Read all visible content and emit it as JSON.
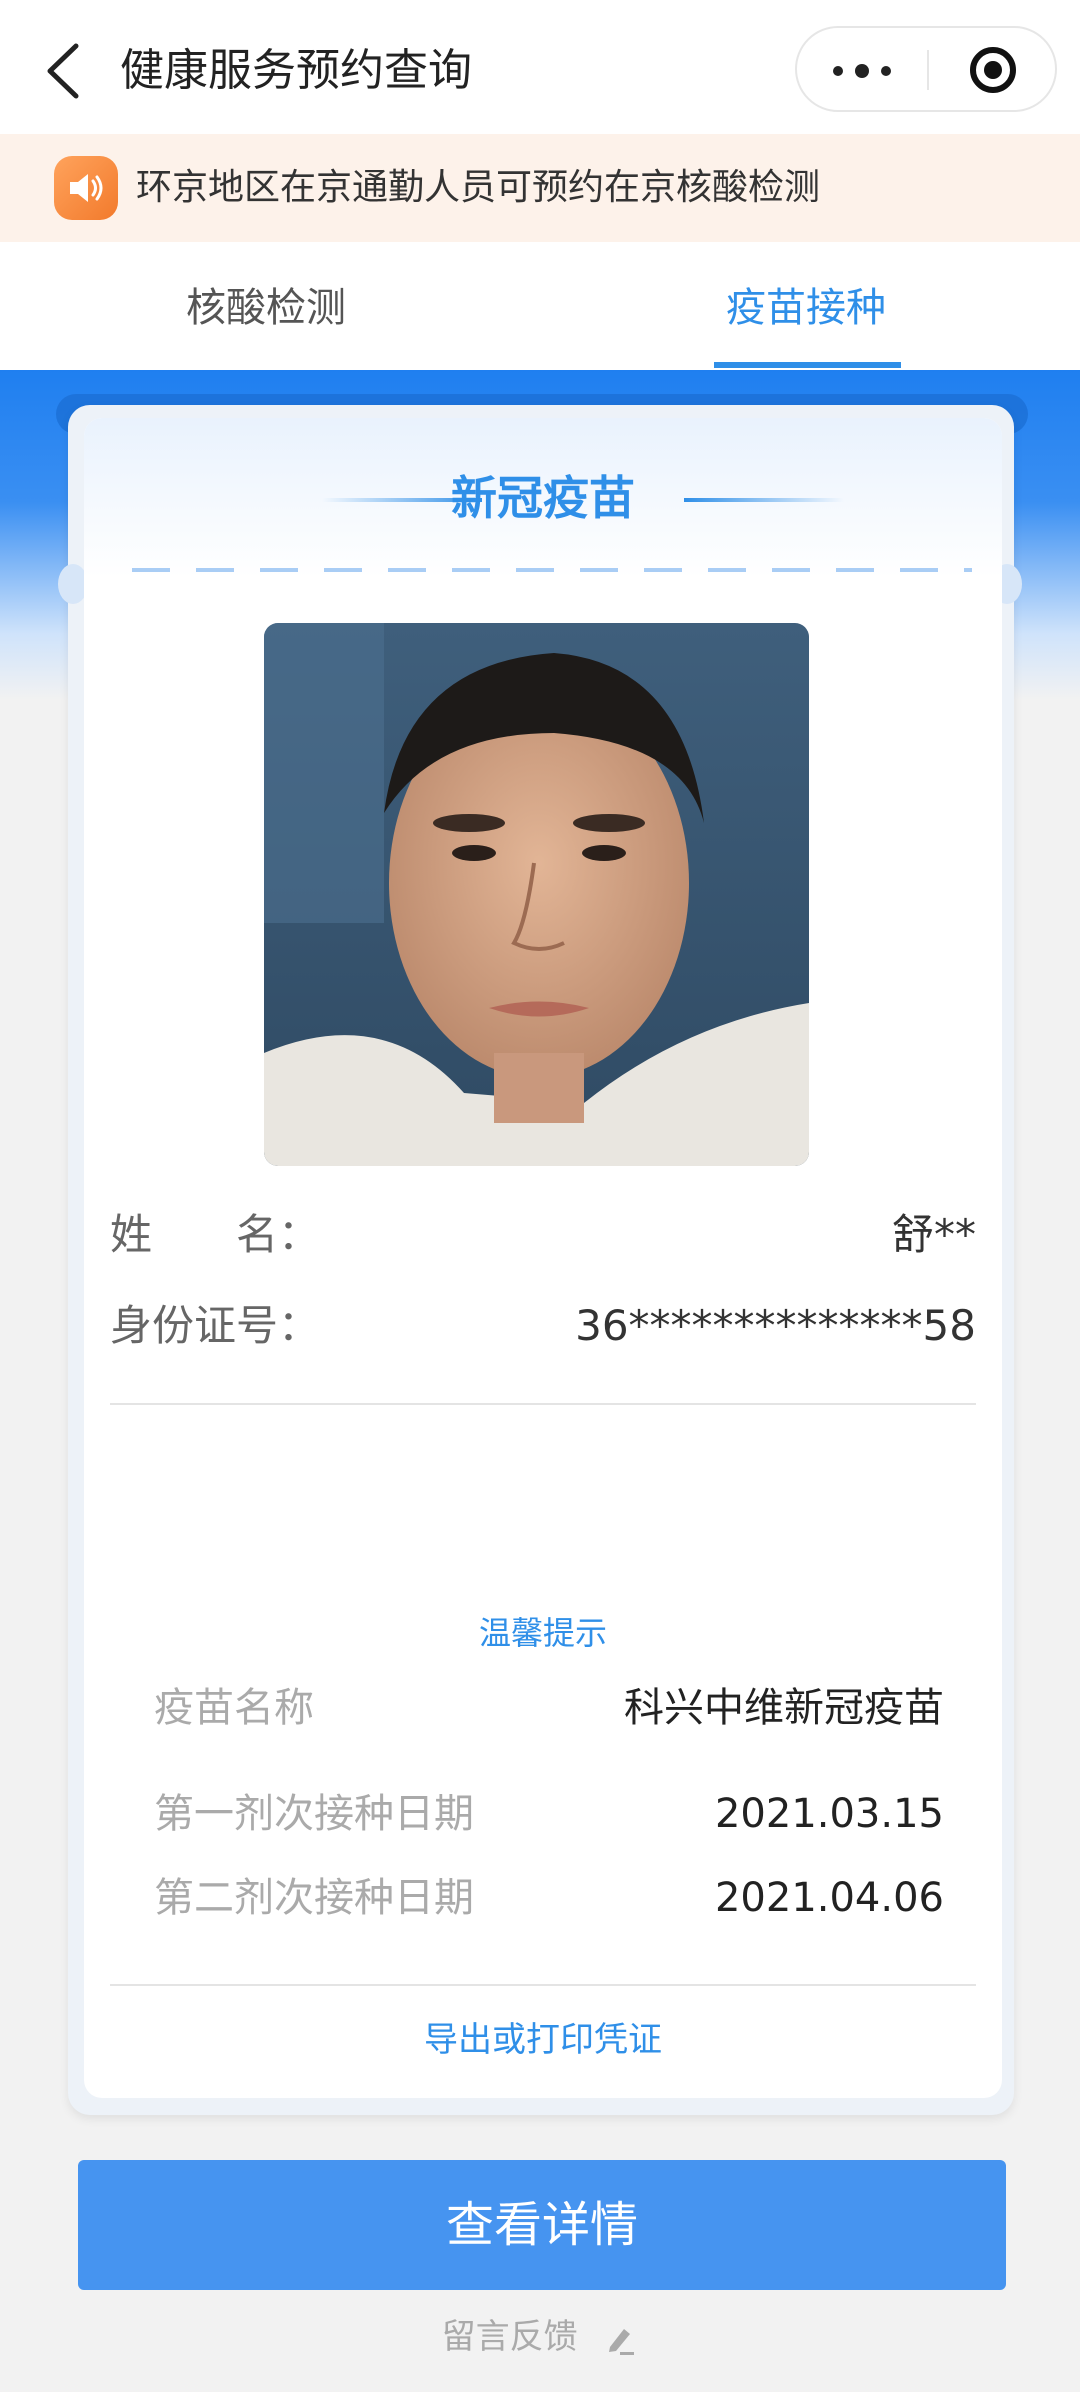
{
  "header": {
    "title": "健康服务预约查询"
  },
  "notice": {
    "text": "环京地区在京通勤人员可预约在京核酸检测"
  },
  "tabs": [
    {
      "label": "核酸检测",
      "active": false
    },
    {
      "label": "疫苗接种",
      "active": true
    }
  ],
  "card": {
    "title": "新冠疫苗",
    "name_label": "姓　　名：",
    "name_value": "舒**",
    "id_label": "身份证号：",
    "id_value": "36**************58",
    "tip": "温馨提示",
    "vaccine_name_label": "疫苗名称",
    "vaccine_name_value": "科兴中维新冠疫苗",
    "dose1_label": "第一剂次接种日期",
    "dose1_value": "2021.03.15",
    "dose2_label": "第二剂次接种日期",
    "dose2_value": "2021.04.06",
    "export_label": "导出或打印凭证"
  },
  "buttons": {
    "detail": "查看详情",
    "feedback": "留言反馈"
  },
  "colors": {
    "accent": "#2f8fe8",
    "button": "#4694f0",
    "notice_bg": "#fdf2ea"
  }
}
